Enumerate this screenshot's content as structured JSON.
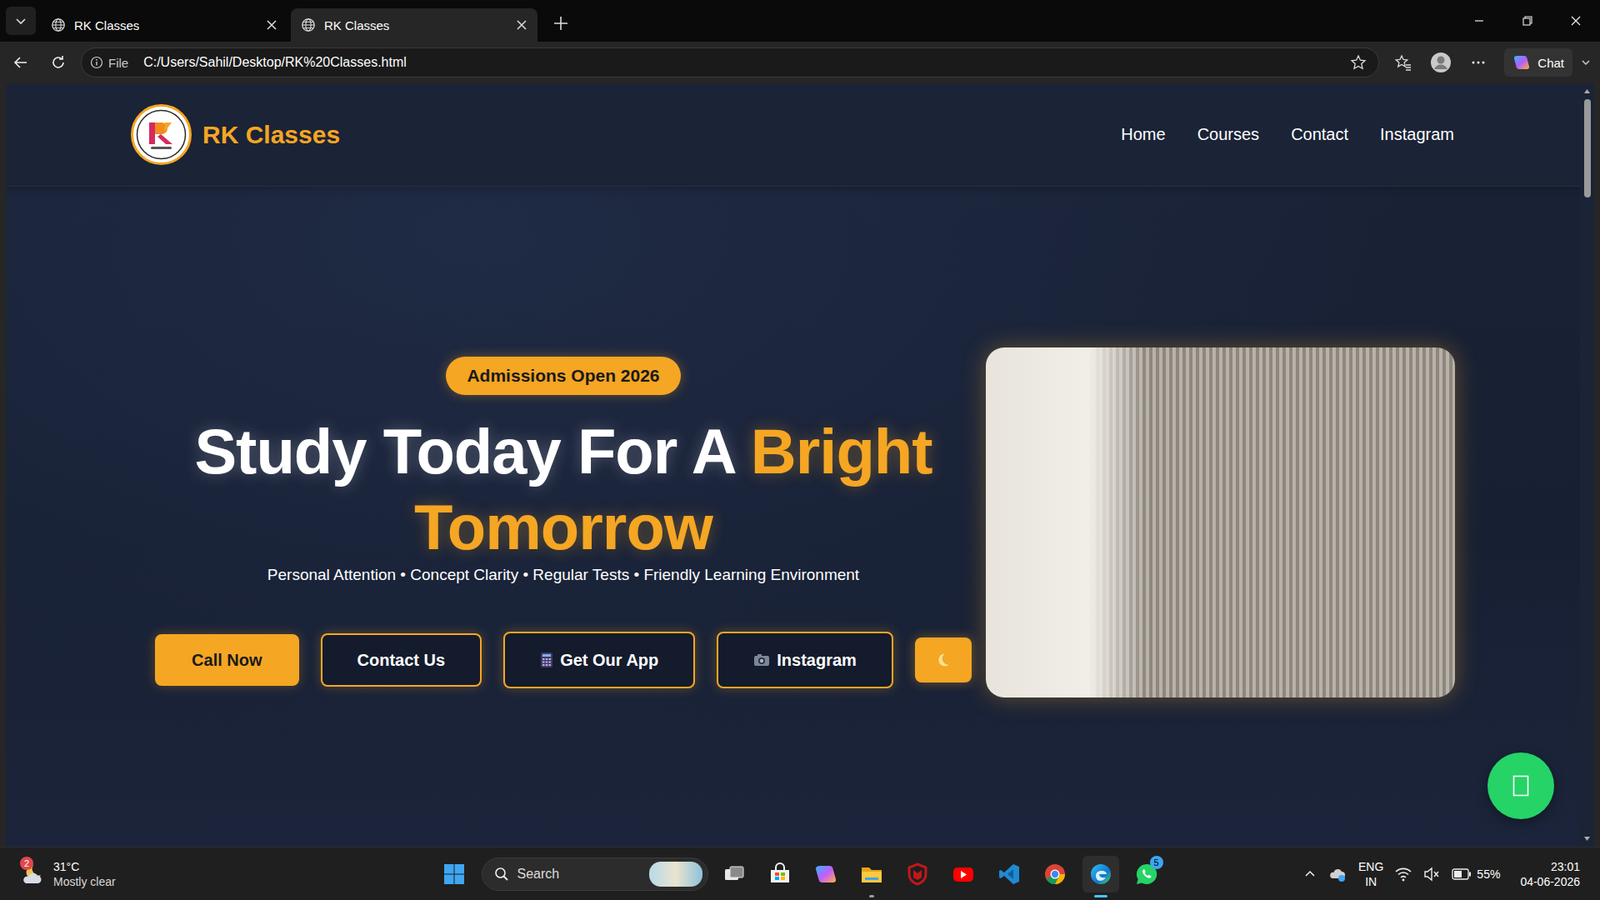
{
  "browser": {
    "tabs": [
      {
        "label": "RK Classes",
        "selected": false
      },
      {
        "label": "RK Classes",
        "selected": true
      }
    ],
    "address": {
      "scheme": "File",
      "url": "C:/Users/Sahil/Desktop/RK%20Classes.html"
    },
    "copilot": {
      "label": "Chat"
    }
  },
  "page": {
    "brand": "RK Classes",
    "nav": [
      {
        "label": "Home"
      },
      {
        "label": "Courses"
      },
      {
        "label": "Contact"
      },
      {
        "label": "Instagram"
      }
    ],
    "hero": {
      "badge": "Admissions Open 2026",
      "title": "Study Today For A",
      "title_highlight": "Bright Tomorrow",
      "subtitle": "Personal Attention • Concept Clarity • Regular Tests • Friendly Learning Environment",
      "buttons": [
        {
          "label": "Call Now",
          "kind": "primary"
        },
        {
          "label": "Contact Us",
          "kind": "outline"
        },
        {
          "label": "Get Our App",
          "kind": "app"
        },
        {
          "label": "Instagram",
          "kind": "social"
        }
      ]
    }
  },
  "taskbar": {
    "weather": {
      "temperature": "31°C",
      "condition": "Mostly clear",
      "badge": "2"
    },
    "search": {
      "placeholder": "Search"
    },
    "apps": [
      {
        "kind": "taskview",
        "running": false,
        "active": false
      },
      {
        "kind": "store",
        "running": false,
        "active": false
      },
      {
        "kind": "copilot",
        "running": false,
        "active": false
      },
      {
        "kind": "explorer",
        "running": true,
        "active": false
      },
      {
        "kind": "mcafee",
        "running": false,
        "active": false
      },
      {
        "kind": "youtube",
        "running": false,
        "active": false
      },
      {
        "kind": "vscode",
        "running": false,
        "active": false
      },
      {
        "kind": "chrome",
        "running": false,
        "active": false
      },
      {
        "kind": "edge",
        "running": true,
        "active": true
      },
      {
        "kind": "whatsapp",
        "running": false,
        "active": false,
        "badge": "5"
      }
    ],
    "tray": {
      "language": "ENG",
      "region": "IN",
      "battery": "55%",
      "time": "23:01",
      "date": "04-06-2026"
    }
  }
}
